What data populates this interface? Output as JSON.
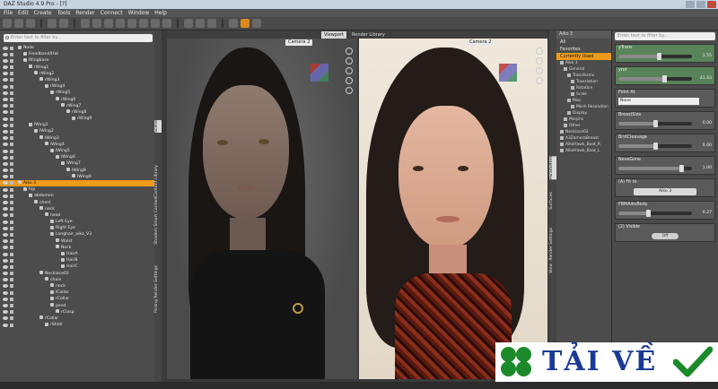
{
  "window": {
    "title": "DAZ Studio 4.9 Pro - [?]"
  },
  "menubar": [
    "File",
    "Edit",
    "Create",
    "Tools",
    "Render",
    "Connect",
    "Window",
    "Help"
  ],
  "scene": {
    "search_placeholder": "Enter text to filter by...",
    "nodes": [
      {
        "label": "Node",
        "indent": 0
      },
      {
        "label": "Headband/Hat",
        "indent": 1
      },
      {
        "label": "Wingbase",
        "indent": 1
      },
      {
        "label": "rWing1",
        "indent": 2
      },
      {
        "label": "rWing2",
        "indent": 3
      },
      {
        "label": "rWing3",
        "indent": 4
      },
      {
        "label": "rWing4",
        "indent": 5
      },
      {
        "label": "rWing5",
        "indent": 6
      },
      {
        "label": "rWing6",
        "indent": 7
      },
      {
        "label": "rWing7",
        "indent": 8
      },
      {
        "label": "rWing8",
        "indent": 9
      },
      {
        "label": "rWing9",
        "indent": 10
      },
      {
        "label": "lWing1",
        "indent": 2
      },
      {
        "label": "lWing2",
        "indent": 3
      },
      {
        "label": "lWing3",
        "indent": 4
      },
      {
        "label": "lWing4",
        "indent": 5
      },
      {
        "label": "lWing5",
        "indent": 6
      },
      {
        "label": "lWing6",
        "indent": 7
      },
      {
        "label": "lWing7",
        "indent": 8
      },
      {
        "label": "lWing8",
        "indent": 9
      },
      {
        "label": "lWing9",
        "indent": 10
      },
      {
        "label": "Aiko 3",
        "indent": 0,
        "selected": true
      },
      {
        "label": "hip",
        "indent": 1
      },
      {
        "label": "abdomen",
        "indent": 2
      },
      {
        "label": "chest",
        "indent": 3
      },
      {
        "label": "neck",
        "indent": 4
      },
      {
        "label": "head",
        "indent": 5
      },
      {
        "label": "Left Eye",
        "indent": 6
      },
      {
        "label": "Right Eye",
        "indent": 6
      },
      {
        "label": "Longhair_aiko_V3",
        "indent": 6
      },
      {
        "label": "Waist",
        "indent": 7
      },
      {
        "label": "Neck",
        "indent": 7
      },
      {
        "label": "HairA",
        "indent": 8
      },
      {
        "label": "HairB",
        "indent": 8
      },
      {
        "label": "HairC",
        "indent": 8
      },
      {
        "label": "Necklace02",
        "indent": 4
      },
      {
        "label": "chain",
        "indent": 5
      },
      {
        "label": "neck",
        "indent": 6
      },
      {
        "label": "lCollar",
        "indent": 6
      },
      {
        "label": "rCollar",
        "indent": 6
      },
      {
        "label": "pend",
        "indent": 6
      },
      {
        "label": "rClasp",
        "indent": 7
      },
      {
        "label": "rCollar",
        "indent": 4
      },
      {
        "label": "rShldr",
        "indent": 5
      }
    ]
  },
  "left_vtabs": [
    "Scene",
    "Content Library",
    "Smart Content",
    "Shaders",
    "Render Settings",
    "Posing"
  ],
  "viewport": {
    "tabs": [
      "Viewport",
      "Render Library"
    ],
    "left_camera": "Camera 2",
    "right_camera": "Camera 2"
  },
  "mid_vtabs": [
    "Parameters",
    "Surfaces",
    "Render Settings",
    "View"
  ],
  "properties": {
    "title": "Aiko 3",
    "categories": [
      "All",
      "Favorites",
      "Currently Used"
    ],
    "selected_category": "Currently Used",
    "tree": [
      "Aiko 3",
      "General",
      "Transforms",
      "Translation",
      "Rotation",
      "Scale",
      "Misc",
      "Mesh Resolution",
      "Display",
      "Morphs",
      "Other",
      "Necklace02",
      "A3ZameraBreast",
      "AikoHawk_Boot_R",
      "AikoHawk_Boot_L"
    ]
  },
  "parameters": {
    "search_placeholder": "Enter text to filter by...",
    "items": [
      {
        "name": "yTrans",
        "value": "1.55",
        "fill": 0.55,
        "highlight": true
      },
      {
        "name": "yrot",
        "value": "41.43",
        "fill": 0.62,
        "highlight": true
      },
      {
        "name": "Point At",
        "field": "None",
        "type": "field"
      },
      {
        "name": "BreastSize",
        "value": "0.00",
        "fill": 0.5
      },
      {
        "name": "BrstCleavage",
        "value": "0.00",
        "fill": 0.5
      },
      {
        "name": "NeveGone",
        "value": "1.00",
        "fill": 0.85
      },
      {
        "name": "(A) Fit to",
        "button": "Aiko 3",
        "type": "button"
      },
      {
        "name": "FBMAikoBody",
        "value": "0.27",
        "fill": 0.4
      },
      {
        "name": "(2) Visible",
        "toggle": "Off",
        "type": "toggle"
      }
    ]
  },
  "watermark": {
    "text": "TẢI VỀ"
  },
  "colors": {
    "accent": "#f09a1a",
    "panel": "#4c4c4c",
    "watermark_text": "#1a3a96",
    "clover": "#1c8a2a"
  }
}
